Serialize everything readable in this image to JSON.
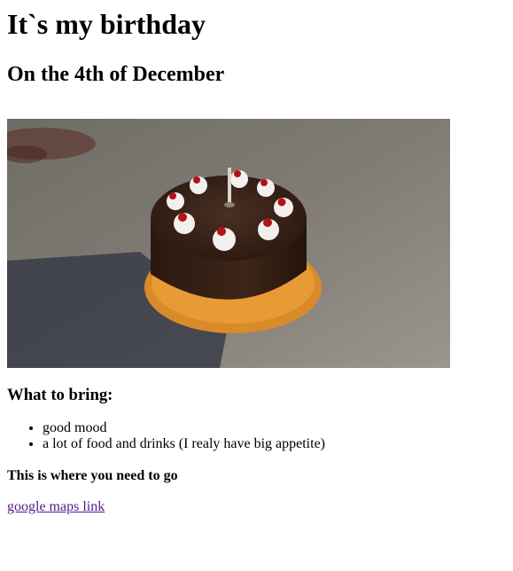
{
  "page": {
    "title": "It`s my birthday",
    "subtitle": "On the 4th of December"
  },
  "image": {
    "subject": "chocolate cake with cherries and whipped cream on a plate, single candle"
  },
  "bring": {
    "heading": "What to bring:",
    "items": [
      "good mood",
      "a lot of food and drinks (I realy have big appetite)"
    ]
  },
  "location": {
    "heading": "This is where you need to go",
    "link_text": "google maps link"
  },
  "colors": {
    "link_visited": "#551a8b",
    "text": "#000000",
    "background": "#ffffff"
  }
}
